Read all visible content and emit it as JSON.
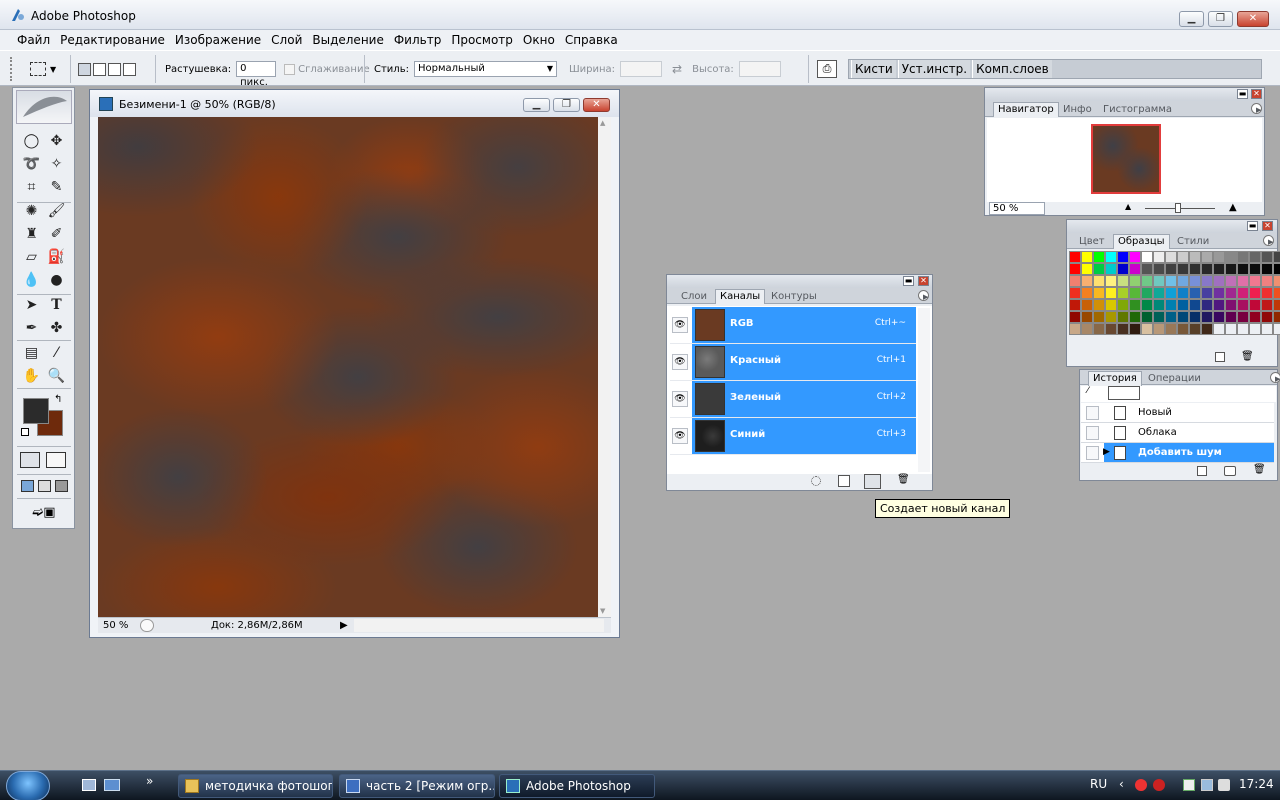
{
  "app": {
    "title": "Adobe Photoshop"
  },
  "menu": [
    "Файл",
    "Редактирование",
    "Изображение",
    "Слой",
    "Выделение",
    "Фильтр",
    "Просмотр",
    "Окно",
    "Справка"
  ],
  "options": {
    "feather_label": "Растушевка:",
    "feather_value": "0 пикс.",
    "antialias_label": "Сглаживание",
    "style_label": "Стиль:",
    "style_value": "Нормальный",
    "width_label": "Ширина:",
    "height_label": "Высота:"
  },
  "palette_well": [
    "Кисти",
    "Уст.инстр.",
    "Комп.слоев"
  ],
  "document": {
    "title": "Безимени-1 @ 50% (RGB/8)",
    "zoom": "50 %",
    "doc_size": "Док: 2,86M/2,86M"
  },
  "navigator": {
    "tabs": [
      "Навигатор",
      "Инфо",
      "Гистограмма"
    ],
    "active_tab": "Навигатор",
    "zoom": "50 %"
  },
  "swatches": {
    "tabs": [
      "Цвет",
      "Образцы",
      "Стили"
    ],
    "active_tab": "Образцы",
    "colors": [
      [
        "#ff0000",
        "#ffff00",
        "#00ff00",
        "#00ffff",
        "#0000ff",
        "#ff00ff",
        "#ffffff",
        "#eeeeee",
        "#dddddd",
        "#cccccc",
        "#bbbbbb",
        "#aaaaaa",
        "#999999",
        "#888888",
        "#777777",
        "#666666",
        "#555555",
        "#444444"
      ],
      [
        "#ff0000",
        "#ffff00",
        "#00cc44",
        "#00cccc",
        "#0000cc",
        "#cc00cc",
        "#555555",
        "#4a4a4a",
        "#404040",
        "#383838",
        "#303030",
        "#282828",
        "#202020",
        "#181818",
        "#101010",
        "#0c0c0c",
        "#060606",
        "#000000"
      ],
      [
        "#f08070",
        "#f8b070",
        "#fde070",
        "#fff280",
        "#c8e080",
        "#90d070",
        "#70c888",
        "#70c8c0",
        "#70c0e8",
        "#70a8e0",
        "#7890d8",
        "#8878c8",
        "#a070c0",
        "#c070b8",
        "#e070a8",
        "#f07890",
        "#f08080",
        "#f09070"
      ],
      [
        "#ee3020",
        "#f48020",
        "#f8b820",
        "#fff020",
        "#a8d028",
        "#58b838",
        "#20a860",
        "#10a898",
        "#10a0d8",
        "#1080c8",
        "#2860b0",
        "#4840a0",
        "#7030a0",
        "#a02890",
        "#d02078",
        "#ee2050",
        "#ee3030",
        "#ee5020"
      ],
      [
        "#c01808",
        "#c86008",
        "#d09008",
        "#d8c800",
        "#80a808",
        "#309020",
        "#008848",
        "#008878",
        "#0080b0",
        "#0060a0",
        "#104890",
        "#302880",
        "#501880",
        "#801070",
        "#a81060",
        "#c00838",
        "#c01818",
        "#c03808"
      ],
      [
        "#900800",
        "#984800",
        "#a06800",
        "#a89800",
        "#607800",
        "#206808",
        "#006030",
        "#006058",
        "#006088",
        "#004878",
        "#083068",
        "#201860",
        "#380860",
        "#600050",
        "#780040",
        "#900020",
        "#900808",
        "#902800"
      ],
      [
        "#c8a888",
        "#a88868",
        "#886848",
        "#684830",
        "#483020",
        "#301c10",
        "#d8c0a0",
        "#b89878",
        "#987858",
        "#785838",
        "#584028",
        "#402818",
        "#eceff3",
        "#eceff3",
        "#eceff3",
        "#eceff3",
        "#eceff3",
        "#eceff3"
      ]
    ]
  },
  "channels": {
    "tabs": [
      "Слои",
      "Каналы",
      "Контуры"
    ],
    "active_tab": "Каналы",
    "rows": [
      {
        "name": "RGB",
        "shortcut": "Ctrl+~"
      },
      {
        "name": "Красный",
        "shortcut": "Ctrl+1"
      },
      {
        "name": "Зеленый",
        "shortcut": "Ctrl+2"
      },
      {
        "name": "Синий",
        "shortcut": "Ctrl+3"
      }
    ]
  },
  "tooltip": "Создает новый канал",
  "history": {
    "tabs": [
      "История",
      "Операции"
    ],
    "active_tab": "История",
    "items": [
      "Новый",
      "Облака",
      "Добавить шум"
    ],
    "selected_index": 2
  },
  "colors": {
    "foreground": "#2b2b2b",
    "background": "#6e2a0c",
    "selection": "#3399ff",
    "canvas_base": "#6a3a22"
  },
  "taskbar": {
    "items": [
      {
        "label": "методичка фотошоп",
        "icon": "folder-icon"
      },
      {
        "label": "часть 2 [Режим огр...",
        "icon": "word-doc-icon"
      },
      {
        "label": "Adobe Photoshop",
        "icon": "photoshop-icon"
      }
    ],
    "lang": "RU",
    "clock": "17:24"
  }
}
